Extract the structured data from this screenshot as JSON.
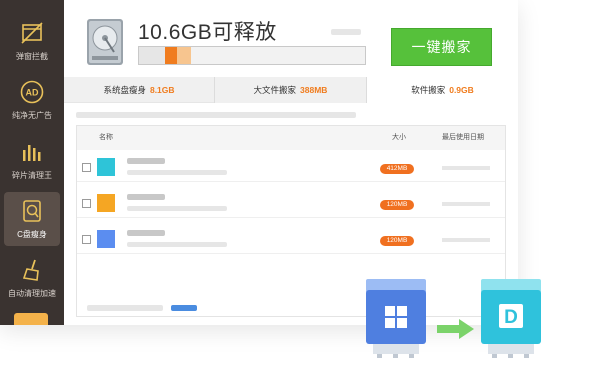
{
  "sidebar": {
    "items": [
      {
        "label": "弹窗拦截",
        "icon": "popup-block-icon"
      },
      {
        "label": "纯净无广告",
        "icon": "ad-free-icon",
        "badge": "AD"
      },
      {
        "label": "碎片清理王",
        "icon": "fragment-clean-icon"
      },
      {
        "label": "C盘瘦身",
        "icon": "c-drive-slim-icon",
        "active": true
      },
      {
        "label": "自动清理加速",
        "icon": "auto-clean-broom-icon"
      }
    ]
  },
  "header": {
    "title": "10.6GB可释放",
    "progress_used_fraction": 0.23,
    "primary_button": "一键搬家"
  },
  "stats": [
    {
      "label": "系统盘瘦身",
      "value": "8.1GB"
    },
    {
      "label": "大文件搬家",
      "value": "388MB"
    },
    {
      "label": "软件搬家",
      "value": "0.9GB",
      "active": true
    }
  ],
  "table": {
    "columns": [
      "名称",
      "大小",
      "最后使用日期"
    ],
    "rows": [
      {
        "icon_color": "#2ec4d8",
        "size": "412MB"
      },
      {
        "icon_color": "#f5a623",
        "size": "120MB"
      },
      {
        "icon_color": "#5b8df0",
        "size": "120MB"
      }
    ]
  },
  "migration": {
    "source_drive": "windows-drive-icon",
    "target_drive": "d-drive-icon",
    "target_letter": "D",
    "colors": {
      "source": "#4f7fe0",
      "target": "#2fc2dc",
      "arrow": "#7bd36a"
    }
  },
  "colors": {
    "accent_orange": "#f07c1e",
    "green_button": "#56c13b",
    "sidebar": "#3a3330"
  }
}
